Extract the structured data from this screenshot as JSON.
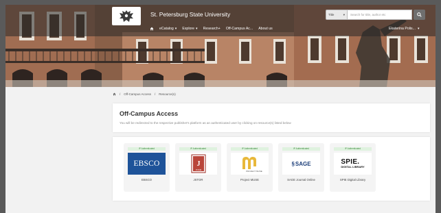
{
  "header": {
    "university_name": "St. Petersburg State University",
    "search": {
      "type_label": "Title",
      "placeholder": "Search for title, author etc"
    },
    "nav": [
      {
        "label": "eCatalog",
        "dropdown": true
      },
      {
        "label": "Explore",
        "dropdown": true
      },
      {
        "label": "Research+",
        "dropdown": false
      },
      {
        "label": "Off-Campus Ac...",
        "dropdown": false
      },
      {
        "label": "About us",
        "dropdown": false
      }
    ],
    "user": "Ekaterina Polis..."
  },
  "breadcrumb": {
    "first": "Off-Campus Access",
    "second": "Resource(s)"
  },
  "page": {
    "title": "Off-Campus Access",
    "subtitle": "You will be redirected to the respective publisher's platform as an authenticated user by clicking on resource(s) listed below"
  },
  "resources": [
    {
      "badge": "IP Authenticated",
      "name": "EBSCO",
      "logo_text": "EBSCO"
    },
    {
      "badge": "IP Authenticated",
      "name": "JSTOR",
      "logo_text": "JSTOR"
    },
    {
      "badge": "IP Authenticated",
      "name": "Project MUSE",
      "logo_text": "PROJECT MUSE"
    },
    {
      "badge": "IP Authenticated",
      "name": "SAGE Journal Online",
      "logo_text": "SAGE"
    },
    {
      "badge": "IP Authenticated",
      "name": "SPIE Digital Library",
      "logo_text": "SPIE.",
      "logo_text2": "DIGITAL LIBRARY"
    }
  ],
  "colors": {
    "ebsco": "#1e5399",
    "badge_bg": "#dff2df",
    "badge_text": "#3d8a3d",
    "muse": "#e8b83a",
    "jstor": "#9a2a20"
  }
}
